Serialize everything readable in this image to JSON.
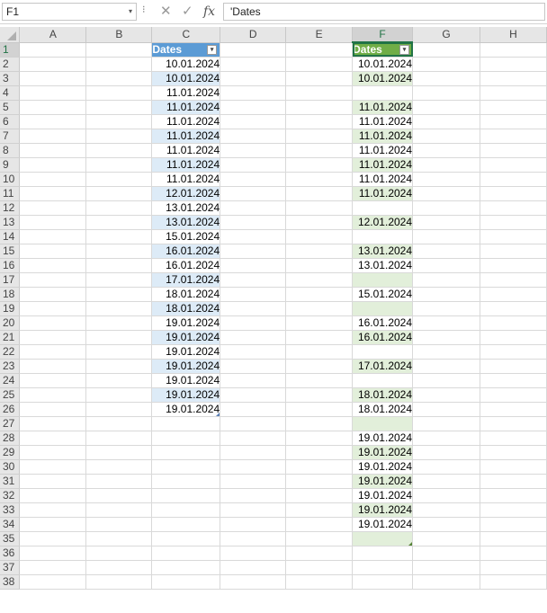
{
  "formula_bar": {
    "name_box": "F1",
    "dropdown_glyph": "▾",
    "menu_glyph": "⁝",
    "cancel_glyph": "✕",
    "confirm_glyph": "✓",
    "fx_glyph": "fx",
    "content": "'Dates"
  },
  "columns": [
    "A",
    "B",
    "C",
    "D",
    "E",
    "F",
    "G",
    "H"
  ],
  "selected_column": "F",
  "selected_row": 1,
  "filter_glyph": "▾",
  "table_c": {
    "header": "Dates",
    "values": [
      "10.01.2024",
      "10.01.2024",
      "11.01.2024",
      "11.01.2024",
      "11.01.2024",
      "11.01.2024",
      "11.01.2024",
      "11.01.2024",
      "11.01.2024",
      "12.01.2024",
      "13.01.2024",
      "13.01.2024",
      "15.01.2024",
      "16.01.2024",
      "16.01.2024",
      "17.01.2024",
      "18.01.2024",
      "18.01.2024",
      "19.01.2024",
      "19.01.2024",
      "19.01.2024",
      "19.01.2024",
      "19.01.2024",
      "19.01.2024",
      "19.01.2024"
    ]
  },
  "table_f": {
    "header": "Dates",
    "values": [
      "10.01.2024",
      "10.01.2024",
      "",
      "11.01.2024",
      "11.01.2024",
      "11.01.2024",
      "11.01.2024",
      "11.01.2024",
      "11.01.2024",
      "11.01.2024",
      "",
      "12.01.2024",
      "",
      "13.01.2024",
      "13.01.2024",
      "",
      "15.01.2024",
      "",
      "16.01.2024",
      "16.01.2024",
      "",
      "17.01.2024",
      "",
      "18.01.2024",
      "18.01.2024",
      "",
      "19.01.2024",
      "19.01.2024",
      "19.01.2024",
      "19.01.2024",
      "19.01.2024",
      "19.01.2024",
      "19.01.2024",
      ""
    ]
  },
  "total_rows": 38,
  "colors": {
    "header_blue": "#5b9bd5",
    "band_blue": "#ddebf7",
    "header_green": "#70ad47",
    "band_green": "#e2efda",
    "excel_green": "#217346"
  }
}
